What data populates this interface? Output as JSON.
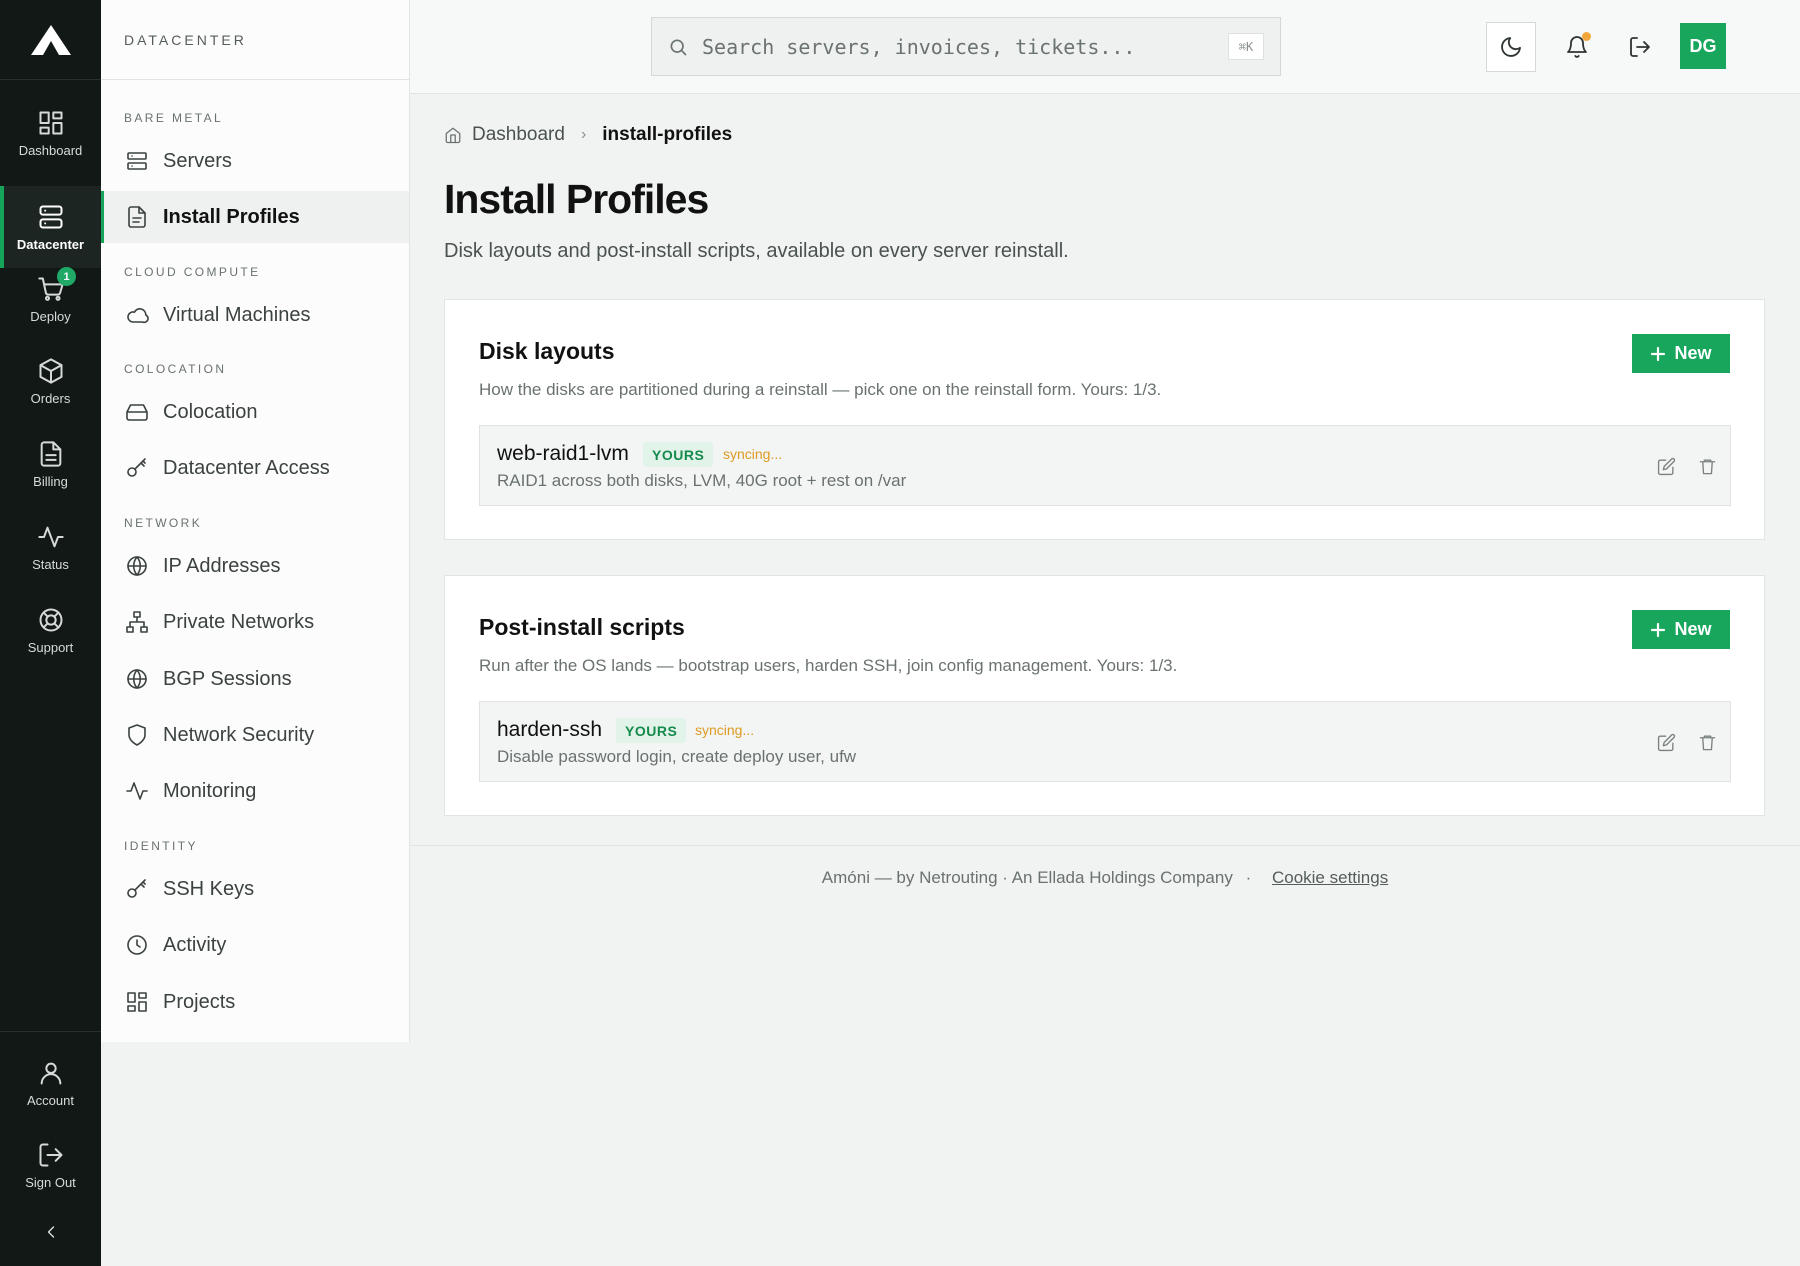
{
  "rail": {
    "items": [
      {
        "label": "Dashboard",
        "icon": "grid-icon"
      },
      {
        "label": "Datacenter",
        "icon": "server-icon"
      },
      {
        "label": "Deploy",
        "icon": "cart-icon",
        "badge": "1"
      },
      {
        "label": "Orders",
        "icon": "box-icon"
      },
      {
        "label": "Billing",
        "icon": "document-icon"
      },
      {
        "label": "Status",
        "icon": "activity-icon"
      },
      {
        "label": "Support",
        "icon": "lifebuoy-icon"
      }
    ],
    "bottom": [
      {
        "label": "Account",
        "icon": "user-icon"
      },
      {
        "label": "Sign Out",
        "icon": "logout-icon"
      }
    ],
    "accent": "#16a35a"
  },
  "subnav": {
    "title": "DATACENTER",
    "sections": [
      {
        "title": "BARE METAL",
        "items": [
          "Servers",
          "Install Profiles"
        ]
      },
      {
        "title": "CLOUD COMPUTE",
        "items": [
          "Virtual Machines"
        ]
      },
      {
        "title": "COLOCATION",
        "items": [
          "Colocation",
          "Datacenter Access"
        ]
      },
      {
        "title": "NETWORK",
        "items": [
          "IP Addresses",
          "Private Networks",
          "BGP Sessions",
          "Network Security",
          "Monitoring"
        ]
      },
      {
        "title": "IDENTITY",
        "items": [
          "SSH Keys",
          "Activity",
          "Projects"
        ]
      }
    ],
    "active": "Install Profiles"
  },
  "topbar": {
    "search_placeholder": "Search servers, invoices, tickets...",
    "shortcut": "⌘K",
    "avatar": "DG"
  },
  "breadcrumb": {
    "home": "Dashboard",
    "current": "install-profiles"
  },
  "page": {
    "title": "Install Profiles",
    "subtitle": "Disk layouts and post-install scripts, available on every server reinstall."
  },
  "disk_layouts": {
    "title": "Disk layouts",
    "description": "How the disks are partitioned during a reinstall — pick one on the reinstall form. Yours: 1/3.",
    "new_label": "New",
    "items": [
      {
        "name": "web-raid1-lvm",
        "badge": "YOURS",
        "status": "syncing...",
        "description": "RAID1 across both disks, LVM, 40G root + rest on /var"
      }
    ]
  },
  "post_install": {
    "title": "Post-install scripts",
    "description": "Run after the OS lands — bootstrap users, harden SSH, join config management. Yours: 1/3.",
    "new_label": "New",
    "items": [
      {
        "name": "harden-ssh",
        "badge": "YOURS",
        "status": "syncing...",
        "description": "Disable password login, create deploy user, ufw"
      }
    ]
  },
  "footer": {
    "text": "Amóni — by Netrouting · An Ellada Holdings Company",
    "separator": "·",
    "link": "Cookie settings"
  }
}
